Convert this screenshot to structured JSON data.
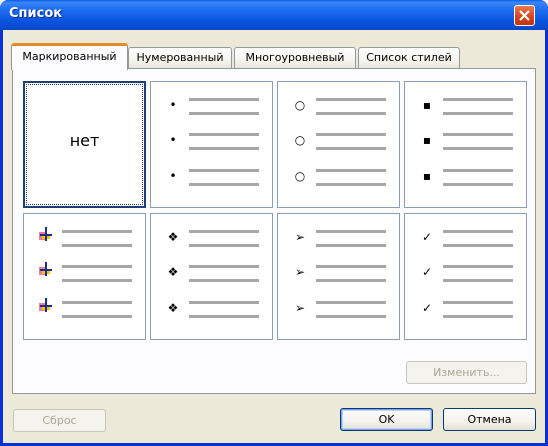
{
  "window": {
    "title": "Список"
  },
  "tabs": [
    {
      "label": "Маркированный",
      "active": true
    },
    {
      "label": "Нумерованный",
      "active": false
    },
    {
      "label": "Многоуровневый",
      "active": false
    },
    {
      "label": "Список стилей",
      "active": false
    }
  ],
  "gallery": {
    "none_label": "нет",
    "styles": [
      {
        "id": "none",
        "selected": true
      },
      {
        "id": "filled-dot",
        "glyph": "•"
      },
      {
        "id": "hollow-circle",
        "glyph": "○"
      },
      {
        "id": "filled-square",
        "glyph": "▪"
      },
      {
        "id": "colored-cross-icon"
      },
      {
        "id": "four-diamonds",
        "glyph": "❖"
      },
      {
        "id": "arrowhead",
        "glyph": "➢"
      },
      {
        "id": "checkmark",
        "glyph": "✓"
      }
    ]
  },
  "buttons": {
    "change": "Изменить...",
    "reset": "Сброс",
    "ok": "OK",
    "cancel": "Отмена"
  },
  "colors": {
    "titlebar": "#0b54e0",
    "active_tab_accent": "#e68b2c",
    "dialog_bg": "#ece9d8",
    "close_button": "#d4431c"
  }
}
